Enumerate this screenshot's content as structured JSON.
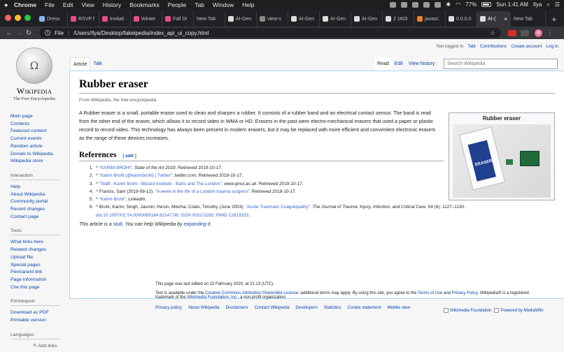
{
  "menubar": {
    "app": "Chrome",
    "items": [
      "File",
      "Edit",
      "View",
      "History",
      "Bookmarks",
      "People",
      "Tab",
      "Window",
      "Help"
    ],
    "battery": "77%",
    "clock": "Sun 1:41 AM",
    "user": "Ilya"
  },
  "tabs": [
    {
      "label": "Dress"
    },
    {
      "label": "RSVP f"
    },
    {
      "label": "Invitati"
    },
    {
      "label": "Winter"
    },
    {
      "label": "Fall Dr"
    },
    {
      "label": "New Tab"
    },
    {
      "label": "AI-Gen"
    },
    {
      "label": "view-s"
    },
    {
      "label": "AI-Gen"
    },
    {
      "label": "AI-Gen"
    },
    {
      "label": "AI-Gen"
    },
    {
      "label": "Z (403"
    },
    {
      "label": "javasc"
    },
    {
      "label": "0.0.0.0"
    },
    {
      "label": "AI-("
    },
    {
      "label": "New Tab"
    }
  ],
  "address": {
    "scheme": "File",
    "path": "/Users/Ilya/Desktop/fakeipedia/index_api_ui_copy.html",
    "avatar": "B"
  },
  "wiki": {
    "wordmark": "Wikipedia",
    "tagline": "The Free Encyclopedia",
    "globe_glyph": "Ω",
    "personal": [
      "Not logged in",
      "Talk",
      "Contributions",
      "Create account",
      "Log in"
    ],
    "ns_tabs": [
      "Article",
      "Talk"
    ],
    "view_tabs": [
      "Read",
      "Edit",
      "View history"
    ],
    "search_placeholder": "Search Wikipedia",
    "nav": [
      "Main page",
      "Contents",
      "Featured content",
      "Current events",
      "Random article",
      "Donate to Wikipedia",
      "Wikipedia store"
    ],
    "interaction_heading": "Interaction",
    "interaction": [
      "Help",
      "About Wikipedia",
      "Community portal",
      "Recent changes",
      "Contact page"
    ],
    "tools_heading": "Tools",
    "tools": [
      "What links here",
      "Related changes",
      "Upload file",
      "Special pages",
      "Permanent link",
      "Page information",
      "Cite this page"
    ],
    "print_heading": "Print/export",
    "print": [
      "Download as PDF",
      "Printable version"
    ],
    "languages_heading": "Languages",
    "add_links": "Add links"
  },
  "article": {
    "title": "Rubber eraser",
    "from": "From Wikipedia, the free encyclopedia",
    "intro": "A Rubber eraser is a small, portable eraser used to clean and sharpen a rubber. It consists of a rubber band and an electrical contact sensor. The band is read from the other end of the eraser, which allows it to record video in WMA or HD. Erasers in the past were electro-mechanical erasers that used a paper or plastic record to record video. This technology has always been present in modern erasers, but it may be replaced with more efficient and convenient electronic erasers as the range of these devices increases.",
    "infobox_title": "Rubber eraser",
    "eraser_label": "ERASER",
    "references_heading": "References",
    "edit_label": "edit",
    "references": [
      {
        "pre": "^ ",
        "link": "\"KARIM BROHI\"",
        "mid": ". ",
        "italic": "State of the Art 2019",
        "post": ". Retrieved 2019-10-17."
      },
      {
        "pre": "^ ",
        "link": "\"Karim Brohi (@karimbrohi) | Twitter\"",
        "mid": ". ",
        "italic": "twitter.com",
        "post": ". Retrieved 2019-10-17."
      },
      {
        "pre": "^ ",
        "link": "\"Staff - Karim Brohi - Blizard Institute - Barts and The London\"",
        "mid": ". ",
        "italic": "www.qmul.ac.uk",
        "post": ". Retrieved 2019-10-17."
      },
      {
        "pre": "^ Francis, Sam (2019-09-12). ",
        "link": "\"A week in the life of a London trauma surgeon\"",
        "mid": ". ",
        "italic": "",
        "post": "Retrieved 2019-10-17."
      },
      {
        "pre": "^ ",
        "link": "\"Karim Brohi\"",
        "mid": ". ",
        "italic": "LinkedIn",
        "post": "."
      },
      {
        "pre": "^ Brohi, Karim; Singh, Jasmin; Heron, Mischa; Coats, Timothy (June 2003). ",
        "link": "\"Acute Traumatic Coagulopathy\"",
        "mid": ". ",
        "italic": "The Journal of Trauma: Injury, Infection, and Critical Care",
        "post": ". 54 (6): 1127–1130."
      }
    ],
    "ref6_line2_doi": "doi:10.1097/01.TA.0000069184.82147.06",
    "ref6_line2_issn": "ISSN 0022-5282",
    "ref6_line2_pmid": "PMID 12813333",
    "stub_pre": "This article is a ",
    "stub_link": "stub",
    "stub_mid": ". You can help Wikipedia by ",
    "stub_link2": "expanding it",
    "stub_post": "."
  },
  "footer": {
    "last_edited": "This page was last edited on 15 February 2020, at 21:13 (UTC).",
    "license_pre": "Text is available under the ",
    "license_link": "Creative Commons Attribution-ShareAlike License",
    "license_mid": "; additional terms may apply. By using this site, you agree to the ",
    "terms_link": "Terms of Use",
    "and": " and ",
    "privacy_link": "Privacy Policy",
    "license_post": ". Wikipedia® is a registered trademark of the ",
    "wmf_link": "Wikimedia Foundation, Inc.",
    "license_end": ", a non-profit organization.",
    "links": [
      "Privacy policy",
      "About Wikipedia",
      "Disclaimers",
      "Contact Wikipedia",
      "Developers",
      "Statistics",
      "Cookie statement",
      "Mobile view"
    ],
    "badges": [
      "Wikimedia Foundation",
      "Powered by MediaWiki"
    ]
  }
}
